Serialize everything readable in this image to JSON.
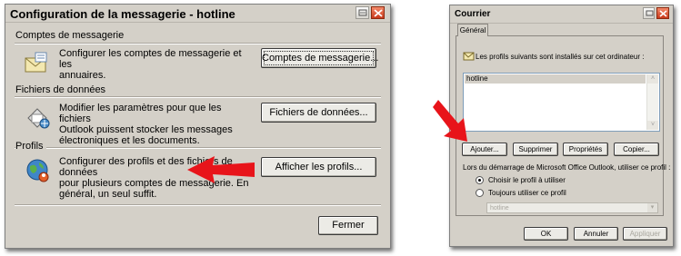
{
  "dialog1": {
    "title": "Configuration de la messagerie - hotline",
    "sections": [
      {
        "heading": "Comptes de messagerie",
        "line1": "Configurer les comptes de messagerie et les",
        "line2": "annuaires.",
        "line3": "",
        "button": "Comptes de messagerie...",
        "icon": "mail-accounts-icon"
      },
      {
        "heading": "Fichiers de données",
        "line1": "Modifier les paramètres pour que les fichiers",
        "line2": "Outlook puissent stocker les messages",
        "line3": "électroniques et les documents.",
        "button": "Fichiers de données...",
        "icon": "data-files-icon"
      },
      {
        "heading": "Profils",
        "line1": "Configurer des profils et des fichiers de données",
        "line2": "pour plusieurs comptes de messagerie. En",
        "line3": "général, un seul suffit.",
        "button": "Afficher les profils...",
        "icon": "profiles-globe-icon"
      }
    ],
    "close_button": "Fermer"
  },
  "dialog2": {
    "title": "Courrier",
    "tab": "Général",
    "info": "Les profils suivants sont installés sur cet ordinateur :",
    "profiles": [
      "hotline"
    ],
    "buttons": {
      "add": "Ajouter...",
      "remove": "Supprimer",
      "properties": "Propriétés",
      "copy": "Copier..."
    },
    "startup_label": "Lors du démarrage de Microsoft Office Outlook, utiliser ce profil :",
    "radio1": "Choisir le profil à utiliser",
    "radio2": "Toujours utiliser ce profil",
    "select_value": "hotline",
    "ok": "OK",
    "cancel": "Annuler",
    "apply": "Appliquer"
  },
  "colors": {
    "arrow": "#e8141a",
    "selection": "#d4d0c8",
    "dialog": "#d4d0c8"
  }
}
